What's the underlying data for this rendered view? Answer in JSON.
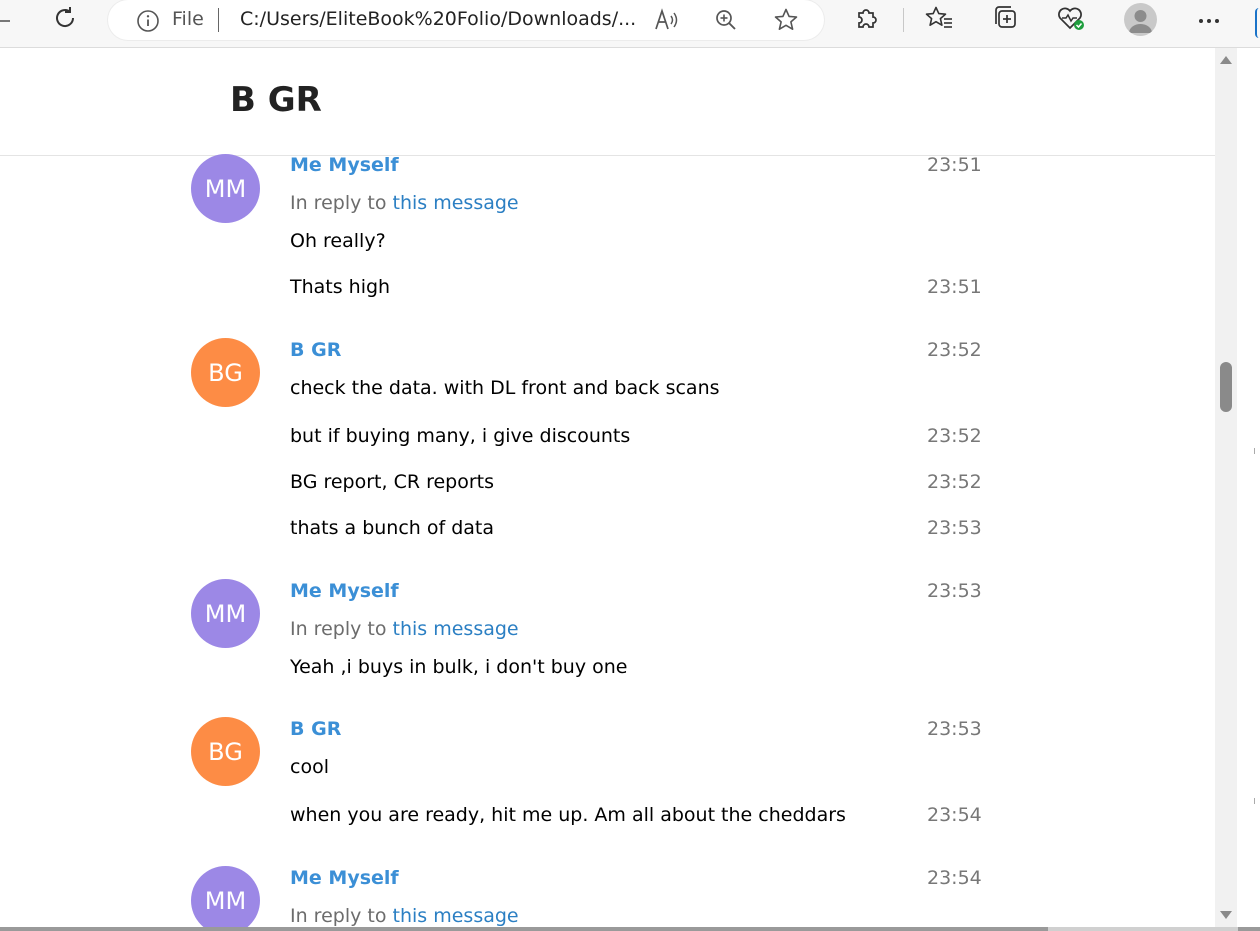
{
  "browser": {
    "address_bar": {
      "scheme_label": "File",
      "url": "C:/Users/EliteBook%20Folio/Downloads/..."
    },
    "icons": [
      "refresh-icon",
      "info-icon",
      "read-aloud-icon",
      "zoom-icon",
      "favorite-star-icon",
      "extensions-icon",
      "favorites-icon",
      "collections-icon",
      "browser-essentials-icon",
      "profile-icon",
      "more-icon"
    ]
  },
  "chat": {
    "title": "B GR",
    "reply_prefix": "In reply to",
    "reply_link": "this message",
    "groups": [
      {
        "initials": "MM",
        "from": "Me Myself",
        "time": "23:51",
        "reply": true,
        "messages": [
          {
            "text": "Oh really?",
            "time": ""
          },
          {
            "text": "Thats high",
            "time": "23:51"
          }
        ]
      },
      {
        "initials": "BG",
        "from": "B GR",
        "time": "23:52",
        "reply": false,
        "messages": [
          {
            "text": "check the data. with DL front and back scans",
            "time": ""
          },
          {
            "text": "but if buying many, i give discounts",
            "time": "23:52"
          },
          {
            "text": "BG report, CR reports",
            "time": "23:52"
          },
          {
            "text": "thats a bunch of data",
            "time": "23:53"
          }
        ]
      },
      {
        "initials": "MM",
        "from": "Me Myself",
        "time": "23:53",
        "reply": true,
        "messages": [
          {
            "text": "Yeah ,i buys in bulk, i don't buy one",
            "time": ""
          }
        ]
      },
      {
        "initials": "BG",
        "from": "B GR",
        "time": "23:53",
        "reply": false,
        "messages": [
          {
            "text": "cool",
            "time": ""
          },
          {
            "text": "when you are ready, hit me up. Am all about the cheddars",
            "time": "23:54"
          }
        ]
      },
      {
        "initials": "MM",
        "from": "Me Myself",
        "time": "23:54",
        "reply": true,
        "messages": []
      }
    ]
  },
  "colors": {
    "avatar_me": "#9c88e6",
    "avatar_bg": "#fd8c45",
    "sender_name": "#3b8fd6",
    "link": "#2b7fc3"
  }
}
